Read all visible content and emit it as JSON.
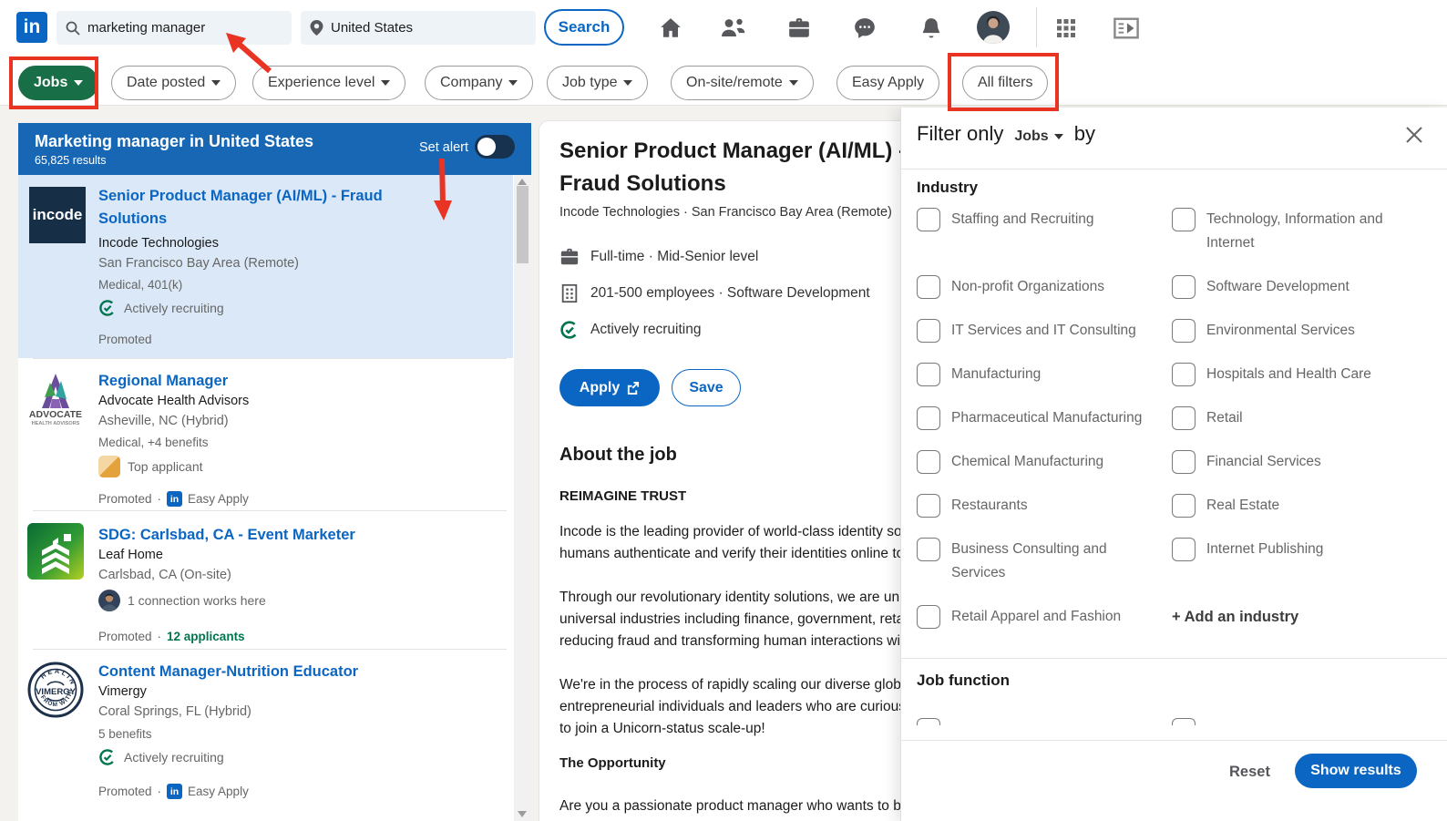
{
  "colors": {
    "accent_blue": "#0a66c2",
    "list_header_blue": "#1767b5",
    "pill_green": "#186e46",
    "annotation_red": "#e93323",
    "applicants_green": "#01754f"
  },
  "nav": {
    "logo": "in",
    "keyword_search": {
      "value": "marketing manager"
    },
    "location_search": {
      "value": "United States"
    },
    "search_button": "Search"
  },
  "filterbar": {
    "scope_pill": "Jobs",
    "pills": [
      {
        "label": "Date posted"
      },
      {
        "label": "Experience level"
      },
      {
        "label": "Company"
      },
      {
        "label": "Job type"
      },
      {
        "label": "On-site/remote"
      },
      {
        "label": "Easy Apply"
      }
    ],
    "all_filters": "All filters"
  },
  "results": {
    "title": "Marketing manager in United States",
    "count": "65,825 results",
    "set_alert_label": "Set alert",
    "jobs": [
      {
        "title": "Senior Product Manager (AI/ML) - Fraud Solutions",
        "company": "Incode Technologies",
        "location": "San Francisco Bay Area (Remote)",
        "benefits": "Medical, 401(k)",
        "insight": "Actively recruiting",
        "footer": {
          "promoted": "Promoted"
        },
        "logo_text": "incode"
      },
      {
        "title": "Regional Manager",
        "company": "Advocate Health Advisors",
        "location": "Asheville, NC (Hybrid)",
        "benefits": "Medical, +4 benefits",
        "insight": "Top applicant",
        "footer": {
          "promoted": "Promoted",
          "sep": "·",
          "easy_apply": "Easy Apply",
          "in": "in"
        },
        "logo_line1": "ADVOCATE",
        "logo_line2": "HEALTH ADVISORS"
      },
      {
        "title": "SDG: Carlsbad, CA - Event Marketer",
        "company": "Leaf Home",
        "location": "Carlsbad, CA (On-site)",
        "insight": "1 connection works here",
        "footer": {
          "promoted": "Promoted",
          "sep": "·",
          "applicants": "12 applicants"
        }
      },
      {
        "title": "Content Manager-Nutrition Educator",
        "company": "Vimergy",
        "location": "Coral Springs, FL (Hybrid)",
        "benefits": "5 benefits",
        "insight": "Actively recruiting",
        "footer": {
          "promoted": "Promoted",
          "sep": "·",
          "easy_apply": "Easy Apply",
          "in": "in"
        },
        "logo_text": "VIMERGY"
      }
    ]
  },
  "detail": {
    "title_line1": "Senior Product Manager (AI/ML) -",
    "title_line2": "Fraud Solutions",
    "company_location": "Incode Technologies ·  San Francisco Bay Area (Remote)",
    "meta_employment": "Full-time · Mid-Senior level",
    "meta_company": "201-500 employees · Software Development",
    "meta_recruiting": "Actively recruiting",
    "apply_button": "Apply",
    "save_button": "Save",
    "about_title": "About the job",
    "about_intro": "REIMAGINE TRUST",
    "para1": [
      "Incode is the leading provider of world-class identity solutions",
      "humans authenticate and verify their identities online to"
    ],
    "para2": [
      "Through our revolutionary identity solutions, we are unlocking",
      "universal industries including finance, government, retail",
      "reducing fraud and transforming human interactions with"
    ],
    "para3": [
      "We're in the process of rapidly scaling our diverse global",
      "entrepreneurial individuals and leaders who are curious",
      "to join a Unicorn-status scale-up!"
    ],
    "opportunity_title": "The Opportunity",
    "last_line": "Are you a passionate product manager who wants to be"
  },
  "modal": {
    "header_prefix": "Filter only",
    "header_scope": "Jobs",
    "header_suffix": "by",
    "industry_title": "Industry",
    "options": [
      {
        "label": "Staffing and Recruiting"
      },
      {
        "label": "Technology, Information and Internet"
      },
      {
        "label": "Non-profit Organizations"
      },
      {
        "label": "Software Development"
      },
      {
        "label": "IT Services and IT Consulting"
      },
      {
        "label": "Environmental Services"
      },
      {
        "label": "Manufacturing"
      },
      {
        "label": "Hospitals and Health Care"
      },
      {
        "label": "Pharmaceutical Manufacturing"
      },
      {
        "label": "Retail"
      },
      {
        "label": "Chemical Manufacturing"
      },
      {
        "label": "Financial Services"
      },
      {
        "label": "Restaurants"
      },
      {
        "label": "Real Estate"
      },
      {
        "label": "Business Consulting and Services"
      },
      {
        "label": "Internet Publishing"
      },
      {
        "label": "Retail Apparel and Fashion"
      }
    ],
    "add_industry": "+ Add an industry",
    "job_function_title": "Job function",
    "reset_button": "Reset",
    "show_results_button": "Show results"
  }
}
